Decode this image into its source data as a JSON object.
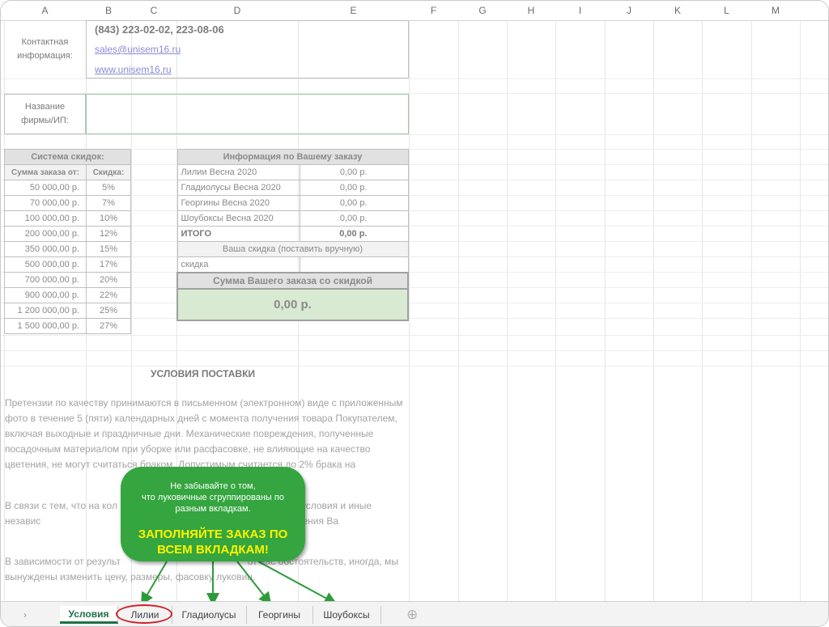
{
  "columns": [
    "A",
    "B",
    "C",
    "D",
    "E",
    "F",
    "G",
    "H",
    "I",
    "J",
    "K",
    "L",
    "M"
  ],
  "contact": {
    "label_line1": "Контактная",
    "label_line2": "информация:",
    "phone": "(843) 223-02-02, 223-08-06",
    "email": "sales@unisem16.ru",
    "website": "www.unisem16.ru"
  },
  "firm": {
    "label_line1": "Название",
    "label_line2": "фирмы/ИП:",
    "value": ""
  },
  "discounts": {
    "title": "Система скидок:",
    "col_sum": "Сумма заказа от:",
    "col_discount": "Скидка:",
    "rows": [
      {
        "sum": "50 000,00 р.",
        "pct": "5%"
      },
      {
        "sum": "70 000,00 р.",
        "pct": "7%"
      },
      {
        "sum": "100 000,00 р.",
        "pct": "10%"
      },
      {
        "sum": "200 000,00 р.",
        "pct": "12%"
      },
      {
        "sum": "350 000,00 р.",
        "pct": "15%"
      },
      {
        "sum": "500 000,00 р.",
        "pct": "17%"
      },
      {
        "sum": "700 000,00 р.",
        "pct": "20%"
      },
      {
        "sum": "900 000,00 р.",
        "pct": "22%"
      },
      {
        "sum": "1 200 000,00 р.",
        "pct": "25%"
      },
      {
        "sum": "1 500 000,00 р.",
        "pct": "27%"
      }
    ]
  },
  "order": {
    "title": "Информация по Вашему заказу",
    "rows": [
      {
        "name": "Лилии Весна 2020",
        "value": "0,00 р."
      },
      {
        "name": "Гладиолусы Весна 2020",
        "value": "0,00 р."
      },
      {
        "name": "Георгины Весна 2020",
        "value": "0,00 р."
      },
      {
        "name": "Шоубоксы Весна 2020",
        "value": "0,00 р."
      }
    ],
    "total_label": "ИТОГО",
    "total_value": "0,00 р.",
    "discount_header": "Ваша скидка (поставить вручную)",
    "discount_label": "скидка",
    "discount_value": "",
    "sum_header": "Сумма Вашего заказа со скидкой",
    "sum_value": "0,00 р."
  },
  "delivery": {
    "title": "УСЛОВИЯ ПОСТАВКИ",
    "para1": "Претензии по качеству принимаются в письменном (электронном) виде с приложенным фото в течение 5 (пяти) календарных дней с момента получения товара Покупателем, включая выходные и праздничные дни. Механические повреждения, полученные посадочным материалом при уборке или расфасовке, не влияющие на качество цветения, не могут считаться браком. Допустимым считается до 2% брака на",
    "para2": "В связи с тем, что на кол                                              ют погодные условия и иные независ                                               арантировать полного исполнения Ва",
    "para3": "В зависимости от результ                                               от нас обстоятельств, иногда, мы вынуждены изменить цену, размеры, фасовку луковиц."
  },
  "callout": {
    "line1": "Не забывайте о том,",
    "line2": "что луковичные сгруппированы по",
    "line3": "разным вкладкам.",
    "cta_line1": "ЗАПОЛНЯЙТЕ ЗАКАЗ ПО",
    "cta_line2": "ВСЕМ ВКЛАДКАМ!"
  },
  "tabs": [
    "Условия",
    "Лилии",
    "Гладиолусы",
    "Георгины",
    "Шоубоксы"
  ],
  "tab_nav_glyph": "›",
  "add_sheet_glyph": "⊕",
  "colors": {
    "accent": "#1e7145",
    "bubble": "#34a53f",
    "cta": "#fff200",
    "highlight_ring": "#d0202a",
    "sum_fill": "#d9ead3"
  }
}
